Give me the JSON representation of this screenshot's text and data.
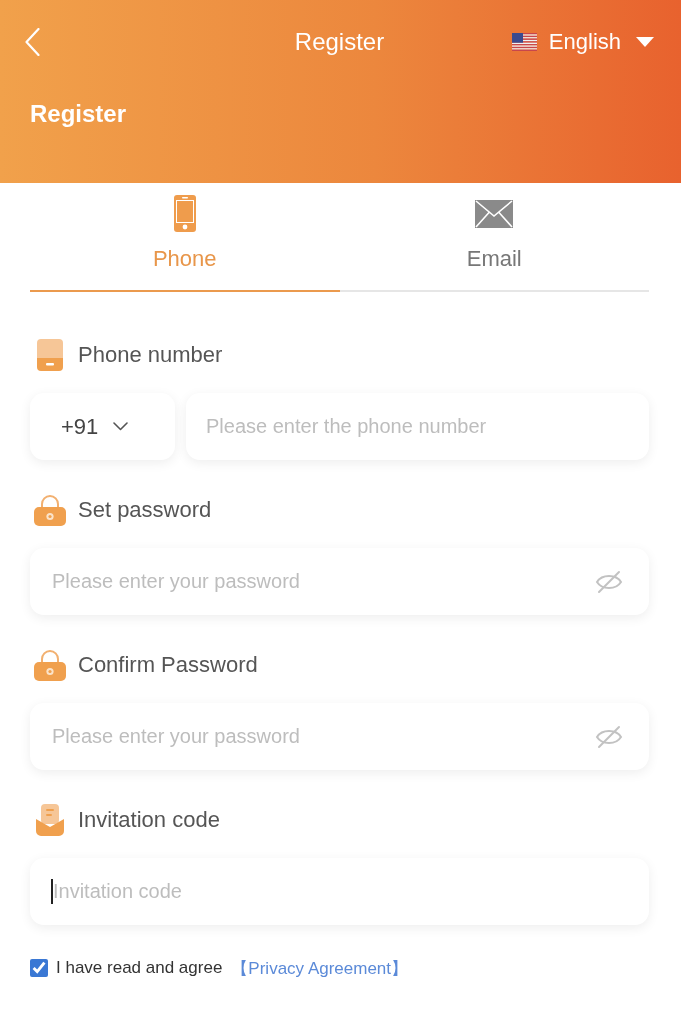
{
  "header": {
    "title": "Register",
    "language": "English",
    "subtitle": "Register"
  },
  "tabs": [
    {
      "kind": "phone",
      "label": "Phone",
      "selected": true
    },
    {
      "kind": "email",
      "label": "Email",
      "selected": false
    }
  ],
  "fields": [
    {
      "kind": "phone",
      "label": "Phone number",
      "country_code": "+91",
      "placeholder": "Please enter the phone number",
      "focused": false
    },
    {
      "kind": "password",
      "label": "Set password",
      "placeholder": "Please enter your password",
      "visible": false,
      "focused": false
    },
    {
      "kind": "password",
      "label": "Confirm Password",
      "placeholder": "Please enter your password",
      "visible": false,
      "focused": false
    },
    {
      "kind": "code",
      "label": "Invitation code",
      "placeholder": "Invitation code",
      "focused": true
    }
  ],
  "agreement": {
    "checked": true,
    "text": "I have read and agree",
    "link": "【Privacy Agreement】"
  }
}
